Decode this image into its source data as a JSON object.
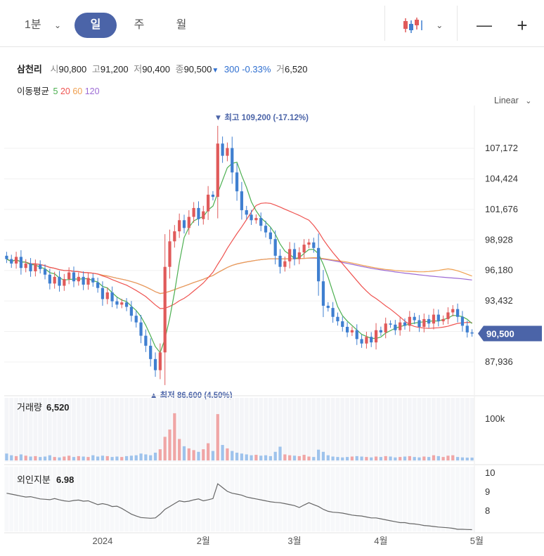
{
  "toolbar": {
    "interval_label": "1분",
    "tabs": [
      "일",
      "주",
      "월"
    ],
    "active_tab": "일",
    "zoom_out": "—",
    "zoom_in": "+"
  },
  "stock": {
    "name": "삼천리",
    "open_label": "시",
    "open": "90,800",
    "high_label": "고",
    "high": "91,200",
    "low_label": "저",
    "low": "90,400",
    "close_label": "종",
    "close": "90,500",
    "change_arrow": "▼",
    "change": "300",
    "change_pct": "-0.33%",
    "volume_label": "거",
    "volume": "6,520"
  },
  "ma": {
    "label": "이동평균",
    "periods": [
      "5",
      "20",
      "60",
      "120"
    ],
    "colors": [
      "#4caf50",
      "#ef5350",
      "#f0a050",
      "#9c6ad4"
    ]
  },
  "scale_label": "Linear",
  "colors": {
    "up": "#e05a5a",
    "down": "#3f7fd0",
    "up_vol": "#f0a6a6",
    "down_vol": "#9ec3ec",
    "badge": "#4b64a8"
  },
  "chart_data": {
    "type": "candlestick",
    "price_axis": {
      "ticks": [
        87936,
        90688,
        93432,
        96180,
        98928,
        101676,
        104424,
        107172
      ],
      "labels": [
        "87,936",
        "93,432",
        "96,180",
        "98,928",
        "101,676",
        "104,424",
        "107,172"
      ]
    },
    "last_price_label": "90,500",
    "last_price": 90500,
    "max_annotation": "▼ 최고 109,200 (-17.12%)",
    "max_value": 109200,
    "min_annotation": "▲ 최저 86,600 (4.50%)",
    "min_value": 86600,
    "x_labels": [
      "2024",
      "2월",
      "3월",
      "4월",
      "5월"
    ],
    "x_label_index": [
      20,
      41,
      60,
      78,
      98
    ],
    "closes": [
      97200,
      96800,
      97400,
      96400,
      96800,
      96100,
      96700,
      96300,
      95800,
      95000,
      95600,
      94800,
      95400,
      96000,
      95200,
      95600,
      94900,
      95500,
      95100,
      94600,
      93600,
      94200,
      93400,
      93100,
      93300,
      92900,
      92100,
      91500,
      90300,
      89400,
      88200,
      87200,
      88800,
      96500,
      98800,
      99700,
      100700,
      100000,
      101000,
      101800,
      100800,
      101500,
      103000,
      102800,
      107600,
      106500,
      107200,
      105000,
      103300,
      101600,
      101200,
      100700,
      100900,
      100200,
      99600,
      99000,
      97500,
      96500,
      97000,
      98100,
      97200,
      97800,
      98500,
      98700,
      98200,
      95200,
      93000,
      92800,
      92000,
      91600,
      91100,
      90600,
      90800,
      90000,
      89600,
      90200,
      89700,
      90800,
      90600,
      91400,
      91300,
      90800,
      91500,
      91200,
      92000,
      91700,
      91100,
      91800,
      91400,
      92200,
      91600,
      91800,
      92400,
      92700,
      92000,
      91200,
      90600,
      90500
    ],
    "volume": {
      "title": "거래량",
      "value": "6,520",
      "axis_label": "100k",
      "axis_value": 100000,
      "values": [
        16000,
        12000,
        10000,
        14000,
        11000,
        9000,
        10000,
        8000,
        9000,
        12000,
        8000,
        7000,
        9000,
        11000,
        8000,
        10000,
        9000,
        8000,
        12000,
        9000,
        11000,
        10000,
        8000,
        9000,
        8000,
        10000,
        11000,
        12000,
        16000,
        14000,
        12000,
        18000,
        26000,
        55000,
        72000,
        110000,
        50000,
        33000,
        28000,
        24000,
        20000,
        26000,
        40000,
        22000,
        108000,
        36000,
        28000,
        22000,
        18000,
        16000,
        14000,
        12000,
        13000,
        11000,
        12000,
        10000,
        20000,
        32000,
        14000,
        12000,
        11000,
        10000,
        13000,
        9000,
        8000,
        25000,
        20000,
        12000,
        9000,
        8000,
        7000,
        8000,
        9000,
        10000,
        9000,
        8000,
        7000,
        9000,
        8000,
        10000,
        9000,
        7000,
        8000,
        9000,
        10000,
        8000,
        7000,
        9000,
        8000,
        12000,
        10000,
        8000,
        11000,
        12000,
        8000,
        7000,
        6500,
        6520
      ]
    },
    "foreign": {
      "title": "외인지분",
      "value": "6.98",
      "axis_ticks": [
        "10",
        "9",
        "8"
      ],
      "values": [
        8.9,
        8.85,
        8.8,
        8.75,
        8.7,
        8.72,
        8.66,
        8.6,
        8.58,
        8.56,
        8.62,
        8.55,
        8.5,
        8.47,
        8.52,
        8.54,
        8.48,
        8.5,
        8.4,
        8.3,
        8.35,
        8.3,
        8.2,
        8.22,
        8.1,
        7.95,
        7.8,
        7.7,
        7.62,
        7.6,
        7.58,
        7.6,
        7.8,
        8.05,
        8.2,
        8.35,
        8.5,
        8.45,
        8.48,
        8.55,
        8.6,
        8.5,
        8.55,
        8.62,
        9.4,
        9.2,
        9.0,
        8.9,
        8.85,
        8.8,
        8.7,
        8.65,
        8.6,
        8.55,
        8.5,
        8.45,
        8.42,
        8.4,
        8.35,
        8.3,
        8.25,
        8.15,
        8.28,
        8.4,
        8.3,
        8.2,
        8.05,
        7.95,
        7.9,
        7.88,
        7.85,
        7.8,
        7.75,
        7.72,
        7.7,
        7.65,
        7.6,
        7.6,
        7.55,
        7.5,
        7.45,
        7.4,
        7.35,
        7.35,
        7.3,
        7.28,
        7.25,
        7.2,
        7.18,
        7.15,
        7.12,
        7.1,
        7.08,
        7.05,
        7.0,
        7.0,
        6.99,
        6.98
      ]
    }
  }
}
